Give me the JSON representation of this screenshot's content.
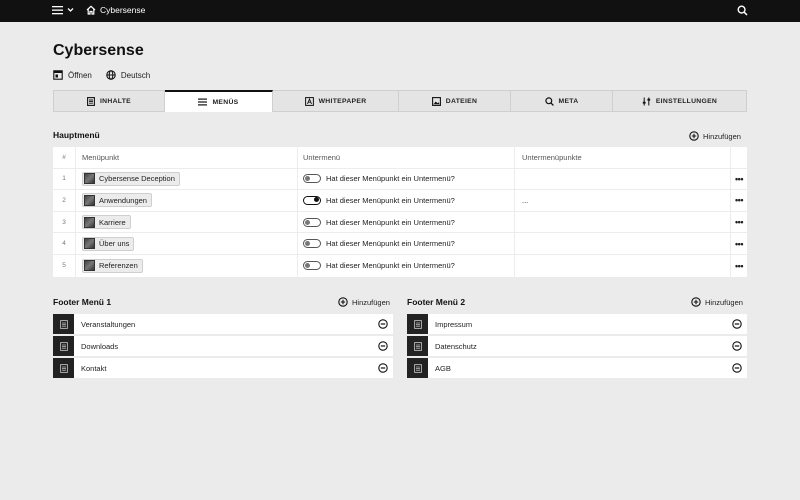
{
  "topbar": {
    "site_name": "Cybersense",
    "menu_icon": "hamburger-icon",
    "search_icon": "search-icon"
  },
  "page": {
    "title": "Cybersense",
    "open_label": "Öffnen",
    "language_label": "Deutsch"
  },
  "tabs": [
    {
      "label": "INHALTE",
      "icon": "document-icon",
      "active": false
    },
    {
      "label": "MENÜS",
      "icon": "menu-lines-icon",
      "active": true
    },
    {
      "label": "WHITEPAPER",
      "icon": "whitepaper-icon",
      "active": false
    },
    {
      "label": "DATEIEN",
      "icon": "image-icon",
      "active": false
    },
    {
      "label": "META",
      "icon": "search-icon",
      "active": false
    },
    {
      "label": "EINSTELLUNGEN",
      "icon": "sliders-icon",
      "active": false
    }
  ],
  "main_menu": {
    "title": "Hauptmenü",
    "add_label": "Hinzufügen",
    "columns": {
      "num": "#",
      "item": "Menüpunkt",
      "submenu": "Untermenü",
      "subitems": "Untermenüpunkte"
    },
    "rows": [
      {
        "num": "1",
        "label": "Cybersense Deception",
        "submenu_question": "Hat dieser Menüpunkt ein Untermenü?",
        "submenu_on": false,
        "subitems": ""
      },
      {
        "num": "2",
        "label": "Anwendungen",
        "submenu_question": "Hat dieser Menüpunkt ein Untermenü?",
        "submenu_on": true,
        "subitems": "..."
      },
      {
        "num": "3",
        "label": "Karriere",
        "submenu_question": "Hat dieser Menüpunkt ein Untermenü?",
        "submenu_on": false,
        "subitems": ""
      },
      {
        "num": "4",
        "label": "Über uns",
        "submenu_question": "Hat dieser Menüpunkt ein Untermenü?",
        "submenu_on": false,
        "subitems": ""
      },
      {
        "num": "5",
        "label": "Referenzen",
        "submenu_question": "Hat dieser Menüpunkt ein Untermenü?",
        "submenu_on": false,
        "subitems": ""
      }
    ],
    "actions_label": "•••"
  },
  "footer_menu_1": {
    "title": "Footer Menü 1",
    "add_label": "Hinzufügen",
    "items": [
      "Veranstaltungen",
      "Downloads",
      "Kontakt"
    ]
  },
  "footer_menu_2": {
    "title": "Footer Menü 2",
    "add_label": "Hinzufügen",
    "items": [
      "Impressum",
      "Datenschutz",
      "AGB"
    ]
  }
}
